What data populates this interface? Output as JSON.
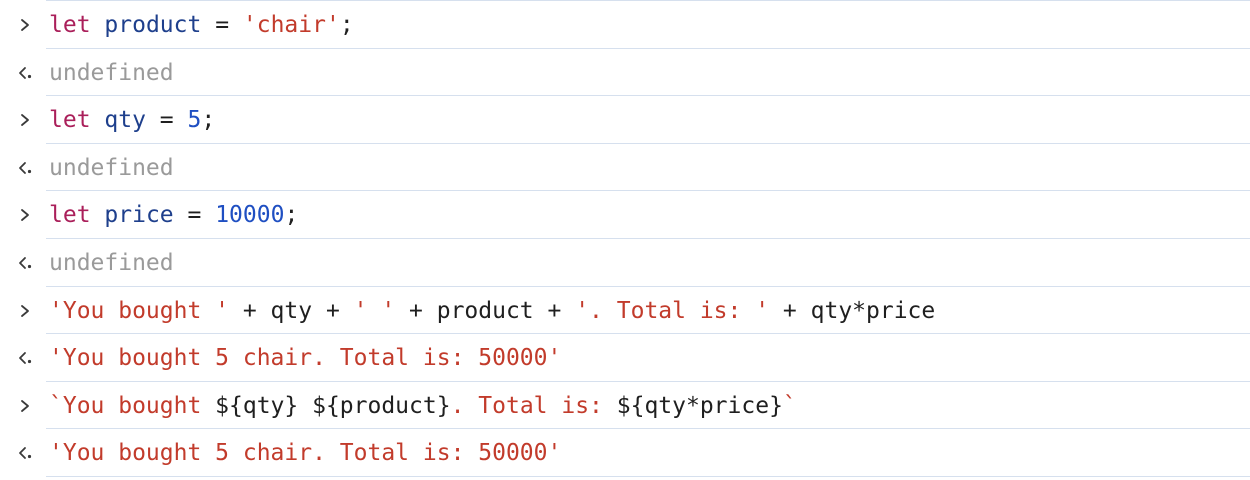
{
  "entries": [
    {
      "kind": "input",
      "tokens": [
        {
          "t": "let",
          "c": "kw"
        },
        {
          "t": " ",
          "c": "plain"
        },
        {
          "t": "product",
          "c": "var"
        },
        {
          "t": " = ",
          "c": "plain"
        },
        {
          "t": "'chair'",
          "c": "str"
        },
        {
          "t": ";",
          "c": "plain"
        }
      ]
    },
    {
      "kind": "output",
      "tokens": [
        {
          "t": "undefined",
          "c": "undef"
        }
      ]
    },
    {
      "kind": "input",
      "tokens": [
        {
          "t": "let",
          "c": "kw"
        },
        {
          "t": " ",
          "c": "plain"
        },
        {
          "t": "qty",
          "c": "var"
        },
        {
          "t": " = ",
          "c": "plain"
        },
        {
          "t": "5",
          "c": "num"
        },
        {
          "t": ";",
          "c": "plain"
        }
      ]
    },
    {
      "kind": "output",
      "tokens": [
        {
          "t": "undefined",
          "c": "undef"
        }
      ]
    },
    {
      "kind": "input",
      "tokens": [
        {
          "t": "let",
          "c": "kw"
        },
        {
          "t": " ",
          "c": "plain"
        },
        {
          "t": "price",
          "c": "var"
        },
        {
          "t": " = ",
          "c": "plain"
        },
        {
          "t": "10000",
          "c": "num"
        },
        {
          "t": ";",
          "c": "plain"
        }
      ]
    },
    {
      "kind": "output",
      "tokens": [
        {
          "t": "undefined",
          "c": "undef"
        }
      ]
    },
    {
      "kind": "input",
      "tokens": [
        {
          "t": "'You bought '",
          "c": "str"
        },
        {
          "t": " + qty + ",
          "c": "plain"
        },
        {
          "t": "' '",
          "c": "str"
        },
        {
          "t": " + product + ",
          "c": "plain"
        },
        {
          "t": "'. Total is: '",
          "c": "str"
        },
        {
          "t": " + qty*price",
          "c": "plain"
        }
      ]
    },
    {
      "kind": "output",
      "tokens": [
        {
          "t": "'You bought 5 chair. Total is: 50000'",
          "c": "str"
        }
      ]
    },
    {
      "kind": "input",
      "tokens": [
        {
          "t": "`You bought ",
          "c": "str"
        },
        {
          "t": "${qty} ${product}",
          "c": "plain"
        },
        {
          "t": ". Total is: ",
          "c": "str"
        },
        {
          "t": "${qty*price}",
          "c": "plain"
        },
        {
          "t": "`",
          "c": "str"
        }
      ]
    },
    {
      "kind": "output",
      "tokens": [
        {
          "t": "'You bought 5 chair. Total is: 50000'",
          "c": "str"
        }
      ]
    }
  ],
  "icons": {
    "input": "chevron-right-icon",
    "output": "return-arrow-icon"
  },
  "colors": {
    "keyword": "#aa1f5a",
    "variable": "#1e3f8c",
    "string": "#c23b2b",
    "number": "#1f4fc2",
    "undefined": "#9a9a9a",
    "divider": "#d6e0ee"
  }
}
